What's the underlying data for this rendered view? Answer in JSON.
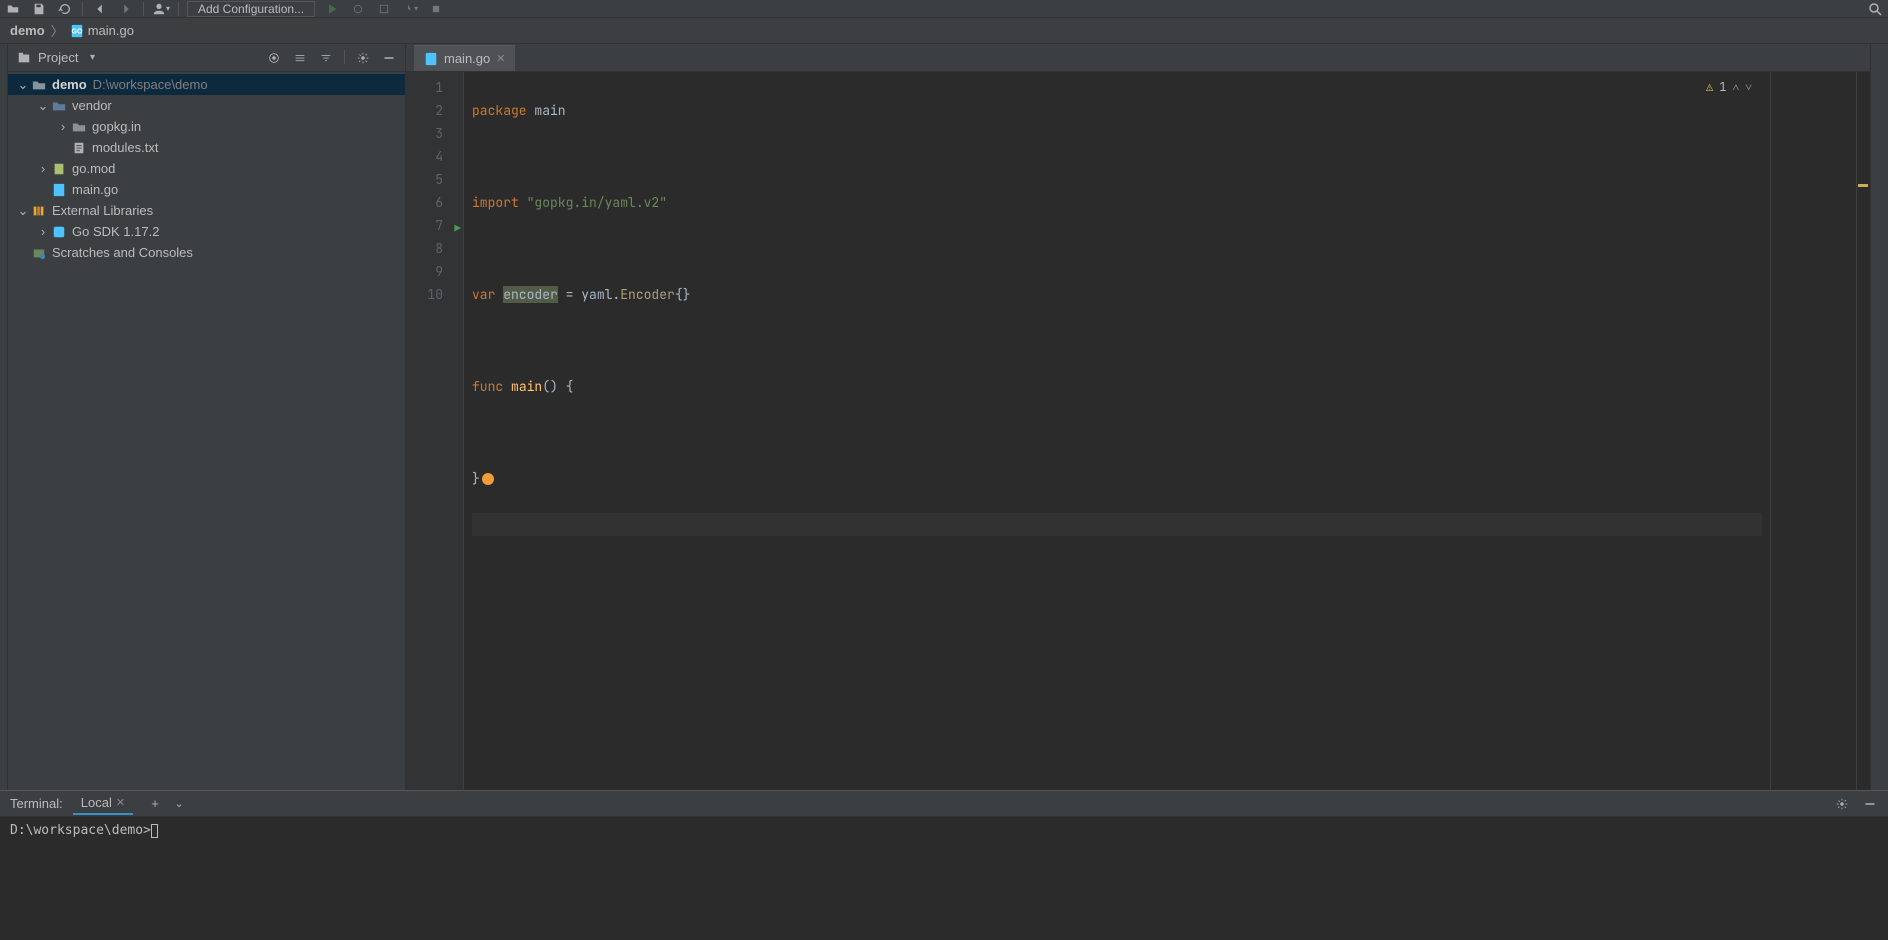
{
  "toolbar": {
    "add_config_label": "Add Configuration..."
  },
  "breadcrumb": {
    "root": "demo",
    "file": "main.go"
  },
  "project_panel": {
    "title": "Project",
    "root": {
      "name": "demo",
      "path": "D:\\workspace\\demo"
    },
    "nodes": {
      "vendor": "vendor",
      "gopkg": "gopkg.in",
      "modules": "modules.txt",
      "gomod": "go.mod",
      "maingo": "main.go",
      "extlibs": "External Libraries",
      "gosdk": "Go SDK 1.17.2",
      "scratches": "Scratches and Consoles"
    }
  },
  "editor": {
    "tab_label": "main.go",
    "warning_count": "1",
    "line_numbers": [
      "1",
      "2",
      "3",
      "4",
      "5",
      "6",
      "7",
      "8",
      "9",
      "10"
    ],
    "code": {
      "l1_kw": "package",
      "l1_pkg": " main",
      "l3_kw": "import",
      "l3_str": " \"gopkg.in/yaml.v2\"",
      "l5_kw": "var ",
      "l5_var": "encoder",
      "l5_eq": " = ",
      "l5_ns": "yaml.",
      "l5_type": "Encoder",
      "l5_braces": "{}",
      "l7_kw": "func ",
      "l7_name": "main",
      "l7_rest": "() {",
      "l9": "}"
    }
  },
  "terminal": {
    "label": "Terminal:",
    "tab": "Local",
    "prompt": "D:\\workspace\\demo>"
  }
}
